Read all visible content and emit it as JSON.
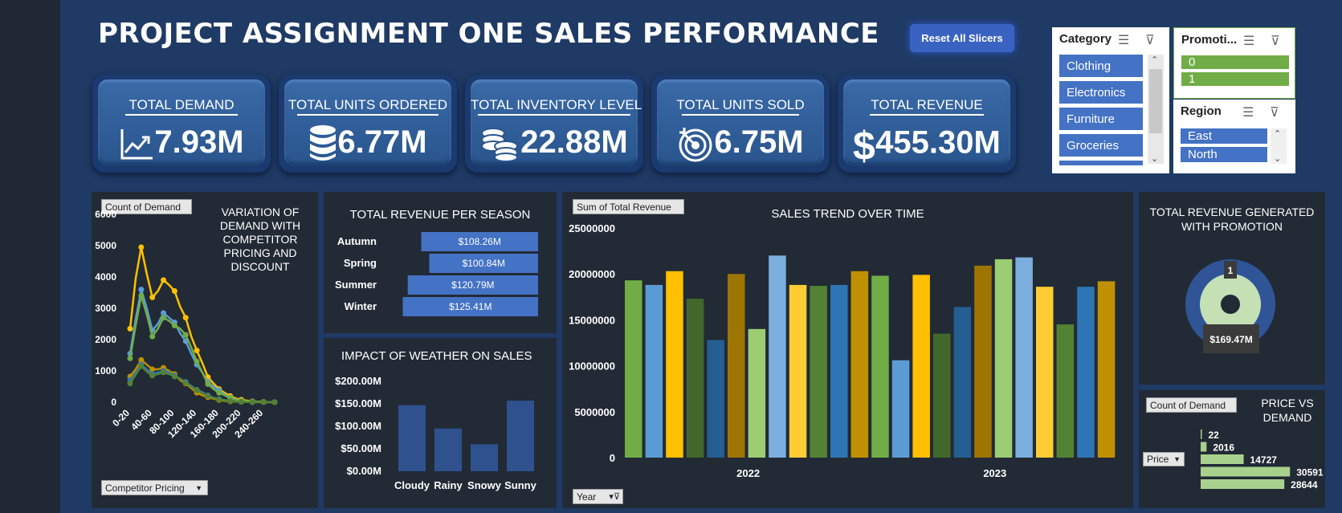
{
  "dashboard": {
    "title": "PROJECT ASSIGNMENT ONE SALES PERFORMANCE",
    "reset_button": "Reset All Slicers"
  },
  "kpis": [
    {
      "label": "TOTAL DEMAND",
      "value": "7.93M",
      "icon": "chart-up-icon"
    },
    {
      "label": "TOTAL UNITS ORDERED",
      "value": "6.77M",
      "icon": "database-icon"
    },
    {
      "label": "TOTAL INVENTORY LEVEL",
      "value": "22.88M",
      "icon": "coins-icon"
    },
    {
      "label": "TOTAL UNITS SOLD",
      "value": "6.75M",
      "icon": "target-icon"
    },
    {
      "label": "TOTAL REVENUE",
      "value": "455.30M",
      "icon": "dollar-icon"
    }
  ],
  "slicers": {
    "category": {
      "title": "Category",
      "items": [
        "Clothing",
        "Electronics",
        "Furniture",
        "Groceries"
      ]
    },
    "promotion": {
      "title": "Promoti...",
      "items": [
        "0",
        "1"
      ]
    },
    "region": {
      "title": "Region",
      "items": [
        "East",
        "North"
      ]
    }
  },
  "colors": {
    "accent_blue": "#4472c4",
    "accent_green": "#70ad47",
    "panel": "#222a35",
    "background": "#1f3a64"
  },
  "panels": {
    "demand_variation": {
      "title_lines": [
        "VARIATION OF",
        "DEMAND WITH",
        "COMPETITOR",
        "PRICING AND",
        "DISCOUNT"
      ],
      "field_button": "Count of Demand",
      "axis_button": "Competitor Pricing"
    },
    "revenue_season": {
      "title": "TOTAL REVENUE PER SEASON"
    },
    "weather": {
      "title": "IMPACT OF WEATHER ON SALES"
    },
    "sales_trend": {
      "title": "SALES TREND OVER TIME",
      "field_button": "Sum of Total Revenue",
      "axis_button": "Year"
    },
    "promotion": {
      "title_lines": [
        "TOTAL REVENUE GENERATED",
        "WITH PROMOTION"
      ]
    },
    "price_demand": {
      "title_lines": [
        "PRICE VS",
        "DEMAND"
      ],
      "field_button": "Count of Demand",
      "axis_button": "Price"
    }
  },
  "chart_data": [
    {
      "type": "line",
      "title": "VARIATION OF DEMAND WITH COMPETITOR PRICING AND DISCOUNT",
      "ylim": [
        0,
        6000
      ],
      "yticks": [
        0,
        1000,
        2000,
        3000,
        4000,
        5000,
        6000
      ],
      "xticks": [
        "0-20",
        "40-60",
        "80-100",
        "120-140",
        "160-180",
        "200-220",
        "240-260"
      ],
      "x": [
        0,
        10,
        20,
        30,
        40,
        50,
        60,
        70,
        80,
        90,
        100,
        110,
        120,
        130,
        140,
        150,
        160,
        170,
        180,
        190,
        200,
        210,
        220,
        230,
        240,
        250,
        260
      ],
      "series": [
        {
          "color": "#ffc000",
          "values": [
            2350,
            3950,
            4950,
            4100,
            3350,
            3550,
            3900,
            3750,
            3550,
            3050,
            2700,
            2100,
            1650,
            1250,
            800,
            600,
            420,
            300,
            200,
            120,
            80,
            50,
            30,
            20,
            10,
            5,
            3
          ]
        },
        {
          "color": "#5b9bd5",
          "values": [
            1550,
            2650,
            3600,
            3000,
            2300,
            2500,
            2850,
            2700,
            2550,
            2200,
            1950,
            1550,
            1200,
            950,
            650,
            500,
            380,
            250,
            150,
            90,
            50,
            30,
            20,
            10,
            5,
            2,
            1
          ]
        },
        {
          "color": "#70ad47",
          "values": [
            1400,
            2450,
            3400,
            2800,
            2100,
            2350,
            2700,
            2600,
            2450,
            2350,
            2150,
            1750,
            1300,
            950,
            580,
            420,
            300,
            220,
            140,
            80,
            50,
            30,
            20,
            15,
            10,
            5,
            4
          ]
        },
        {
          "color": "#bf9000",
          "values": [
            820,
            1050,
            1350,
            1200,
            1050,
            1050,
            1100,
            1000,
            900,
            700,
            600,
            450,
            300,
            220,
            160,
            110,
            70,
            40,
            25,
            15,
            10,
            5,
            3,
            2,
            1,
            1,
            0
          ]
        },
        {
          "color": "#2e75b6",
          "values": [
            700,
            950,
            1200,
            1050,
            900,
            950,
            1000,
            950,
            850,
            750,
            650,
            520,
            400,
            320,
            220,
            150,
            100,
            70,
            40,
            20,
            10,
            5,
            3,
            2,
            1,
            1,
            0
          ]
        },
        {
          "color": "#548235",
          "values": [
            600,
            880,
            1150,
            980,
            850,
            900,
            950,
            900,
            820,
            750,
            620,
            500,
            380,
            290,
            200,
            140,
            90,
            60,
            35,
            18,
            9,
            5,
            3,
            2,
            1,
            1,
            0
          ]
        }
      ]
    },
    {
      "type": "bar",
      "title": "TOTAL REVENUE PER SEASON",
      "categories": [
        "Autumn",
        "Spring",
        "Summer",
        "Winter"
      ],
      "values": [
        108.26,
        100.84,
        120.79,
        125.41
      ],
      "labels": [
        "$108.26M",
        "$100.84M",
        "$120.79M",
        "$125.41M"
      ]
    },
    {
      "type": "bar",
      "title": "IMPACT OF WEATHER ON SALES",
      "categories": [
        "Cloudy",
        "Rainy",
        "Snowy",
        "Sunny"
      ],
      "values": [
        147,
        95,
        60,
        157
      ],
      "ylim": [
        0,
        200
      ],
      "yticks": [
        "$0.00M",
        "$50.00M",
        "$100.00M",
        "$150.00M",
        "$200.00M"
      ]
    },
    {
      "type": "bar",
      "title": "SALES TREND OVER TIME",
      "categories": [
        "2022",
        "2023"
      ],
      "ylim": [
        0,
        25000000
      ],
      "yticks": [
        "0",
        "5000000",
        "10000000",
        "15000000",
        "20000000",
        "25000000"
      ],
      "values": [
        19300000,
        18800000,
        20300000,
        17300000,
        12800000,
        20000000,
        14000000,
        22000000,
        18800000,
        18700000,
        18800000,
        20300000,
        19800000,
        10600000,
        19900000,
        13500000,
        16400000,
        20900000,
        21600000,
        21800000,
        18600000,
        14500000,
        18600000,
        19200000
      ],
      "colors": [
        "#70ad47",
        "#5b9bd5",
        "#ffc000",
        "#43682b",
        "#255e91",
        "#9e7500",
        "#9ccd73",
        "#7cafdd",
        "#ffcd33",
        "#548235",
        "#2e75b6",
        "#bf9000",
        "#70ad47",
        "#5b9bd5",
        "#ffc000",
        "#43682b",
        "#255e91",
        "#9e7500",
        "#9ccd73",
        "#7cafdd",
        "#ffcd33",
        "#548235",
        "#2e75b6",
        "#bf9000"
      ]
    },
    {
      "type": "pie",
      "title": "TOTAL REVENUE GENERATED WITH PROMOTION",
      "categories": [
        "1"
      ],
      "values": [
        169.47
      ],
      "labels": [
        "1",
        "$169.47M"
      ]
    },
    {
      "type": "bar",
      "title": "PRICE VS DEMAND",
      "values": [
        22,
        2016,
        14727,
        30591,
        28644
      ],
      "labels": [
        "22",
        "2016",
        "14727",
        "30591",
        "28644"
      ]
    }
  ]
}
